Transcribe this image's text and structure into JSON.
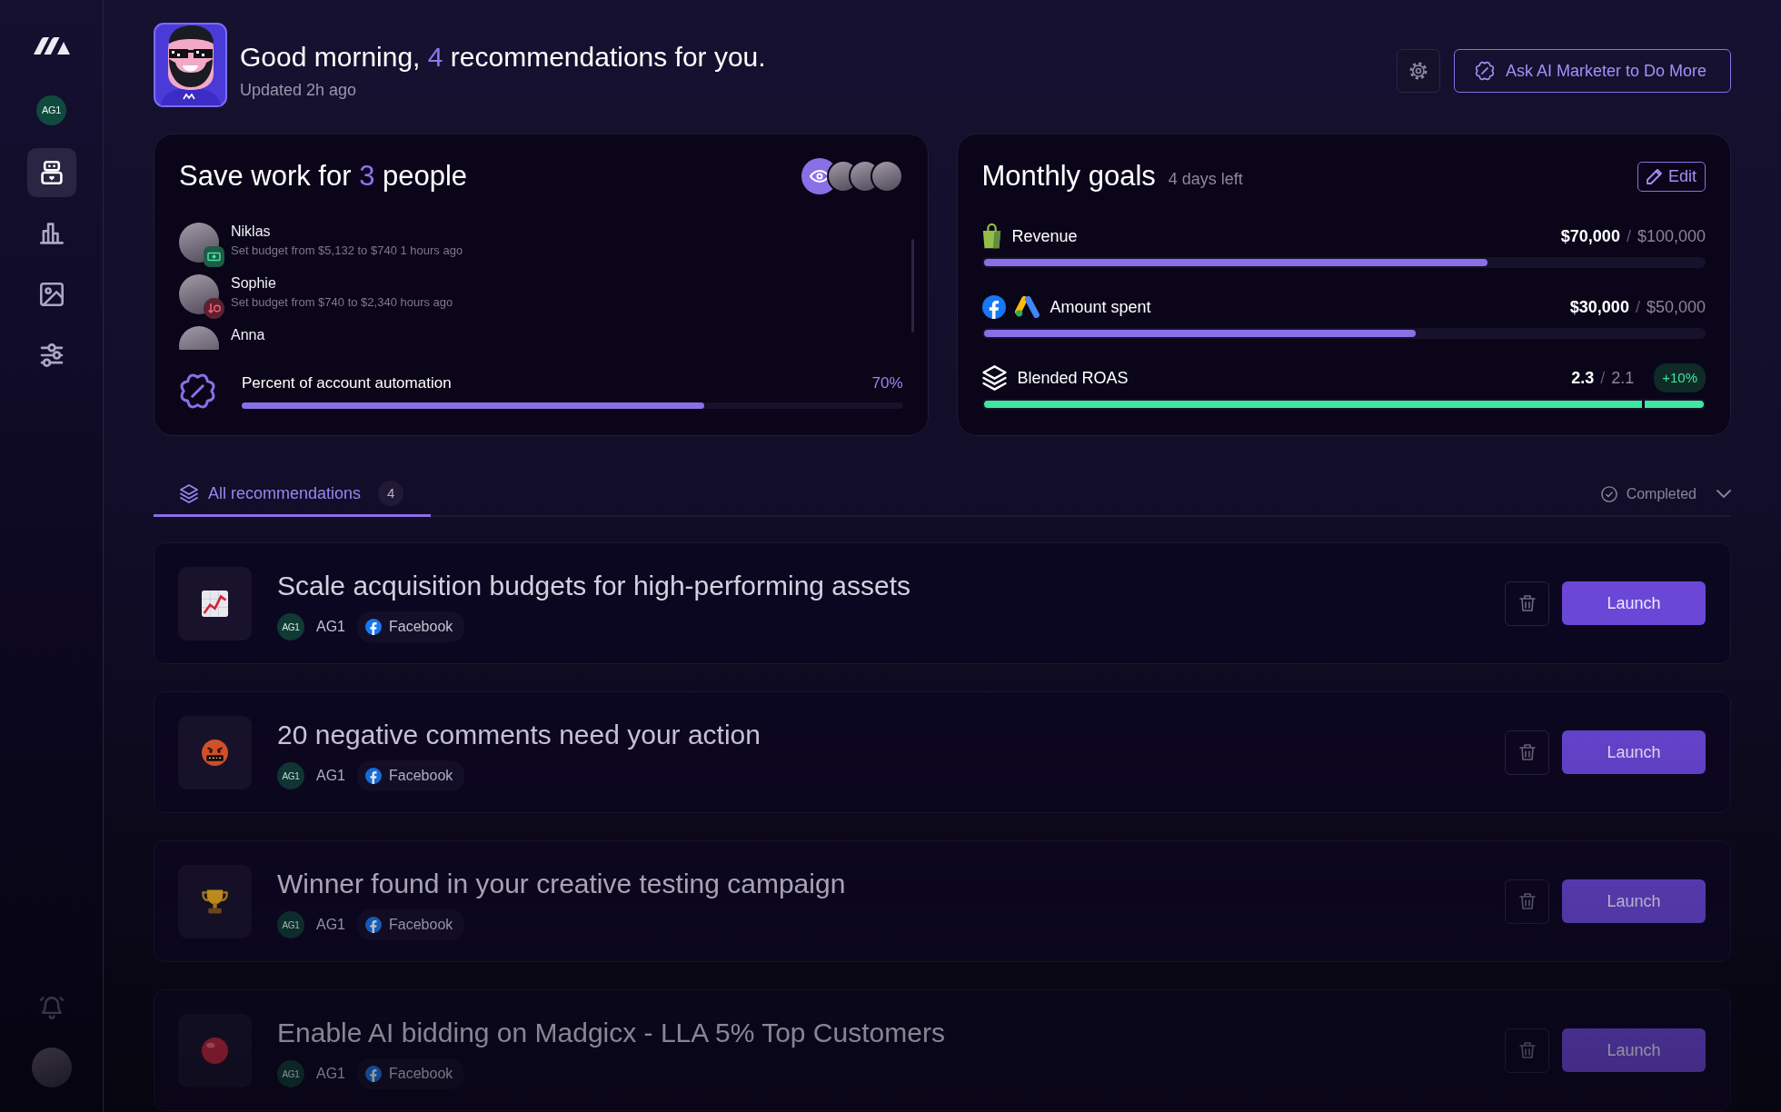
{
  "sidebar": {
    "account_badge": "AG1",
    "nav_items": [
      {
        "kind": "robot",
        "selected": true
      },
      {
        "kind": "chart",
        "selected": false
      },
      {
        "kind": "image",
        "selected": false
      },
      {
        "kind": "sliders",
        "selected": false
      }
    ]
  },
  "header": {
    "greeting": {
      "before": "Good morning,",
      "count": "4",
      "after": "recommendations for you."
    },
    "updated": "Updated 2h ago",
    "ask_button": "Ask AI Marketer to Do More"
  },
  "save_work_card": {
    "title": {
      "before": "Save work for",
      "count": "3",
      "after": "people"
    },
    "activity": [
      {
        "name": "Niklas",
        "detail": "Set budget from $5,132 to $740 1 hours ago",
        "kind": "money"
      },
      {
        "name": "Sophie",
        "detail": "Set budget from $740 to $2,340 hours ago",
        "kind": "decrease"
      },
      {
        "name": "Anna"
      }
    ],
    "automation": {
      "label": "Percent of account automation",
      "value": "70%",
      "level": 0.7
    }
  },
  "goals_card": {
    "title": "Monthly goals",
    "days_left": "4 days left",
    "edit_button": "Edit",
    "goals": [
      {
        "kind": "revenue",
        "label": "Revenue",
        "current": "$70,000",
        "separator": "/",
        "target": "$100,000",
        "level": 0.7,
        "color": "#8b6fe6"
      },
      {
        "kind": "spend",
        "label": "Amount spent",
        "current": "$30,000",
        "separator": "/",
        "target": "$50,000",
        "level": 0.6,
        "color": "#8b6fe6"
      },
      {
        "kind": "roas",
        "label": "Blended ROAS",
        "current": "2.3",
        "separator": "/",
        "target": "2.1",
        "change": "+10%",
        "level": 1,
        "color": "#3ee6a0"
      }
    ]
  },
  "tabs": [
    {
      "label": "All recommendations",
      "count": "4",
      "selected": true
    }
  ],
  "filter": {
    "label": "Completed"
  },
  "recommendations": [
    {
      "kind": "growth",
      "title": "Scale acquisition budgets for high-performing assets",
      "account_badge": "AG1",
      "account": "AG1",
      "platform": "Facebook",
      "button": "Launch"
    },
    {
      "kind": "comments",
      "title": "20 negative comments need your action",
      "account_badge": "AG1",
      "account": "AG1",
      "platform": "Facebook",
      "button": "Launch"
    },
    {
      "kind": "winner",
      "title": "Winner found in your creative testing campaign",
      "account_badge": "AG1",
      "account": "AG1",
      "platform": "Facebook",
      "button": "Launch"
    },
    {
      "kind": "bidding",
      "title": "Enable AI bidding on Madgicx - LLA 5% Top Customers",
      "account_badge": "AG1",
      "account": "AG1",
      "platform": "Facebook",
      "button": "Launch"
    }
  ]
}
